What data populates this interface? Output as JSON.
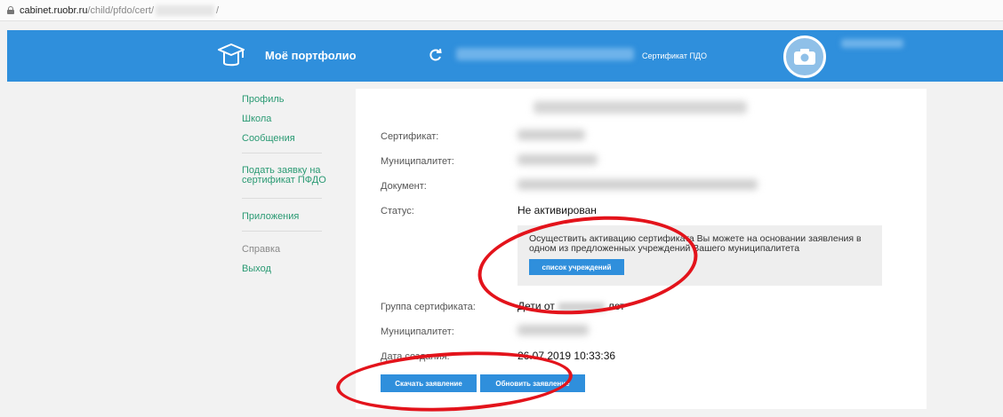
{
  "url": {
    "host": "cabinet.ruobr.ru",
    "path": "/child/pfdo/cert/",
    "suffix": "/"
  },
  "header": {
    "title": "Моё портфолио",
    "cert_link": "Сертификат ПДО",
    "accent": "#2f8fdc"
  },
  "sidebar": {
    "items": [
      {
        "label": "Профиль",
        "icon": ""
      },
      {
        "label": "Школа",
        "icon": ""
      },
      {
        "label": "Сообщения",
        "icon": ""
      },
      {
        "label": "Подать заявку на сертификат ПФДО",
        "icon": ""
      },
      {
        "label": "Приложения",
        "icon": ""
      },
      {
        "label": "Справка",
        "icon": ""
      },
      {
        "label": "Выход",
        "icon": ""
      }
    ],
    "color": "#2a9a73"
  },
  "main": {
    "labels": {
      "certificate": "Сертификат:",
      "municipality": "Муниципалитет:",
      "document": "Документ:",
      "status": "Статус:",
      "group": "Группа сертификата:",
      "municipality2": "Муниципалитет:",
      "created": "Дата создания:"
    },
    "status_value": "Не активирован",
    "notice_text": "Осуществить активацию сертификата Вы можете на основании заявления в одном из предложенных учреждений Вашего муниципалитета",
    "notice_button": "список учреждений",
    "group_value_prefix": "Дети от",
    "group_value_suffix": "лет",
    "created_value": "26.07.2019 10:33:36",
    "download_button": "Скачать заявление",
    "update_button": "Обновить заявление"
  },
  "annotation_color": "#e3131b"
}
